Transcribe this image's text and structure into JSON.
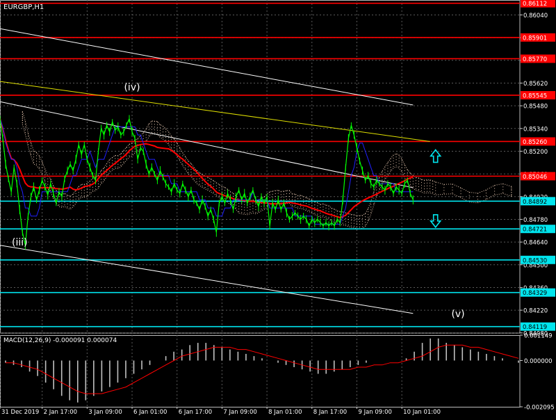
{
  "window_title": "EURGBP,H1",
  "indicator_label": "MACD(12,26,9) -0.000091 0.000074",
  "wave_labels": [
    {
      "text": "(iv)",
      "x": 47.0,
      "y": 0.85575
    },
    {
      "text": "(iii)",
      "x": 7.0,
      "y": 0.8462
    },
    {
      "text": "(v)",
      "x": 163.0,
      "y": 0.84177
    }
  ],
  "colors": {
    "background": "#000000",
    "grid": "#5a5a5a",
    "price": "#00ff00",
    "resistance": "#ff0000",
    "support": "#00e5ee",
    "channel": "#ffffff",
    "yellow_line": "#e0e000",
    "slow_ma": "#ff0000",
    "fast_ma": "#2020ff",
    "cloud": "#e8c8b0",
    "macd_hist": "#c0c0c0",
    "macd_signal": "#ff0000"
  },
  "chart_data": [
    {
      "type": "line",
      "title": "EURGBP,H1",
      "xlabel": "",
      "ylabel": "",
      "grid": true,
      "x_ticks": [
        {
          "label": "31 Dec 2019",
          "x": 0
        },
        {
          "label": "2 Jan 17:00",
          "x": 15
        },
        {
          "label": "3 Jan 09:00",
          "x": 31
        },
        {
          "label": "6 Jan 01:00",
          "x": 47
        },
        {
          "label": "6 Jan 17:00",
          "x": 63
        },
        {
          "label": "7 Jan 09:00",
          "x": 79
        },
        {
          "label": "8 Jan 01:00",
          "x": 95
        },
        {
          "label": "8 Jan 17:00",
          "x": 111
        },
        {
          "label": "9 Jan 09:00",
          "x": 127
        },
        {
          "label": "10 Jan 01:00",
          "x": 143
        }
      ],
      "xlim": [
        0,
        185
      ],
      "ylim": [
        0.84079,
        0.86132
      ],
      "y_ticks": [
        "0.86040",
        "0.85900",
        "0.85760",
        "0.85620",
        "0.85480",
        "0.85340",
        "0.85200",
        "0.85060",
        "0.84920",
        "0.84780",
        "0.84640",
        "0.84500",
        "0.84360",
        "0.84220",
        "0.84080"
      ],
      "resistance_levels": [
        "0.86112",
        "0.85901",
        "0.85770",
        "0.85545",
        "0.85260",
        "0.85046"
      ],
      "support_levels": [
        "0.84892",
        "0.84721",
        "0.84530",
        "0.84329",
        "0.84119"
      ],
      "price_series": [
        {
          "x": 0,
          "y": 0.854
        },
        {
          "x": 1,
          "y": 0.8528
        },
        {
          "x": 2,
          "y": 0.8512
        },
        {
          "x": 3,
          "y": 0.8503
        },
        {
          "x": 4,
          "y": 0.8495
        },
        {
          "x": 5,
          "y": 0.851
        },
        {
          "x": 6,
          "y": 0.85
        },
        {
          "x": 7,
          "y": 0.8484
        },
        {
          "x": 8,
          "y": 0.847
        },
        {
          "x": 9,
          "y": 0.8462
        },
        {
          "x": 10,
          "y": 0.848
        },
        {
          "x": 11,
          "y": 0.8492
        },
        {
          "x": 12,
          "y": 0.8498
        },
        {
          "x": 13,
          "y": 0.849
        },
        {
          "x": 14,
          "y": 0.8496
        },
        {
          "x": 15,
          "y": 0.8502
        },
        {
          "x": 16,
          "y": 0.8498
        },
        {
          "x": 17,
          "y": 0.8493
        },
        {
          "x": 18,
          "y": 0.85
        },
        {
          "x": 19,
          "y": 0.8494
        },
        {
          "x": 20,
          "y": 0.8488
        },
        {
          "x": 21,
          "y": 0.8495
        },
        {
          "x": 22,
          "y": 0.8492
        },
        {
          "x": 23,
          "y": 0.8503
        },
        {
          "x": 24,
          "y": 0.8508
        },
        {
          "x": 25,
          "y": 0.8512
        },
        {
          "x": 26,
          "y": 0.8508
        },
        {
          "x": 27,
          "y": 0.8515
        },
        {
          "x": 28,
          "y": 0.8524
        },
        {
          "x": 29,
          "y": 0.8518
        },
        {
          "x": 30,
          "y": 0.8524
        },
        {
          "x": 31,
          "y": 0.8515
        },
        {
          "x": 32,
          "y": 0.851
        },
        {
          "x": 33,
          "y": 0.8505
        },
        {
          "x": 34,
          "y": 0.8502
        },
        {
          "x": 35,
          "y": 0.852
        },
        {
          "x": 36,
          "y": 0.8534
        },
        {
          "x": 37,
          "y": 0.853
        },
        {
          "x": 38,
          "y": 0.8536
        },
        {
          "x": 39,
          "y": 0.8532
        },
        {
          "x": 40,
          "y": 0.8538
        },
        {
          "x": 41,
          "y": 0.8533
        },
        {
          "x": 42,
          "y": 0.8535
        },
        {
          "x": 43,
          "y": 0.853
        },
        {
          "x": 44,
          "y": 0.8532
        },
        {
          "x": 45,
          "y": 0.8536
        },
        {
          "x": 46,
          "y": 0.854
        },
        {
          "x": 47,
          "y": 0.8532
        },
        {
          "x": 48,
          "y": 0.8528
        },
        {
          "x": 49,
          "y": 0.8515
        },
        {
          "x": 50,
          "y": 0.8522
        },
        {
          "x": 51,
          "y": 0.852
        },
        {
          "x": 52,
          "y": 0.8512
        },
        {
          "x": 53,
          "y": 0.8506
        },
        {
          "x": 54,
          "y": 0.851
        },
        {
          "x": 55,
          "y": 0.8506
        },
        {
          "x": 56,
          "y": 0.8502
        },
        {
          "x": 57,
          "y": 0.8508
        },
        {
          "x": 58,
          "y": 0.8504
        },
        {
          "x": 59,
          "y": 0.85
        },
        {
          "x": 60,
          "y": 0.8498
        },
        {
          "x": 61,
          "y": 0.8495
        },
        {
          "x": 62,
          "y": 0.85
        },
        {
          "x": 63,
          "y": 0.8496
        },
        {
          "x": 64,
          "y": 0.8494
        },
        {
          "x": 65,
          "y": 0.85
        },
        {
          "x": 66,
          "y": 0.8496
        },
        {
          "x": 67,
          "y": 0.8492
        },
        {
          "x": 68,
          "y": 0.8496
        },
        {
          "x": 69,
          "y": 0.849
        },
        {
          "x": 70,
          "y": 0.8488
        },
        {
          "x": 71,
          "y": 0.8484
        },
        {
          "x": 72,
          "y": 0.849
        },
        {
          "x": 73,
          "y": 0.8486
        },
        {
          "x": 74,
          "y": 0.848
        },
        {
          "x": 75,
          "y": 0.8484
        },
        {
          "x": 76,
          "y": 0.8478
        },
        {
          "x": 77,
          "y": 0.847
        },
        {
          "x": 78,
          "y": 0.8488
        },
        {
          "x": 79,
          "y": 0.8492
        },
        {
          "x": 80,
          "y": 0.8488
        },
        {
          "x": 81,
          "y": 0.8494
        },
        {
          "x": 82,
          "y": 0.849
        },
        {
          "x": 83,
          "y": 0.8484
        },
        {
          "x": 84,
          "y": 0.8492
        },
        {
          "x": 85,
          "y": 0.8496
        },
        {
          "x": 86,
          "y": 0.849
        },
        {
          "x": 87,
          "y": 0.8494
        },
        {
          "x": 88,
          "y": 0.8488
        },
        {
          "x": 89,
          "y": 0.8492
        },
        {
          "x": 90,
          "y": 0.8496
        },
        {
          "x": 91,
          "y": 0.849
        },
        {
          "x": 92,
          "y": 0.8486
        },
        {
          "x": 93,
          "y": 0.8492
        },
        {
          "x": 94,
          "y": 0.8488
        },
        {
          "x": 95,
          "y": 0.8492
        },
        {
          "x": 96,
          "y": 0.8474
        },
        {
          "x": 97,
          "y": 0.8488
        },
        {
          "x": 98,
          "y": 0.8484
        },
        {
          "x": 99,
          "y": 0.849
        },
        {
          "x": 100,
          "y": 0.8484
        },
        {
          "x": 101,
          "y": 0.8488
        },
        {
          "x": 102,
          "y": 0.8482
        },
        {
          "x": 103,
          "y": 0.8478
        },
        {
          "x": 104,
          "y": 0.848
        },
        {
          "x": 105,
          "y": 0.8482
        },
        {
          "x": 106,
          "y": 0.848
        },
        {
          "x": 107,
          "y": 0.8478
        },
        {
          "x": 108,
          "y": 0.848
        },
        {
          "x": 109,
          "y": 0.8478
        },
        {
          "x": 110,
          "y": 0.8474
        },
        {
          "x": 111,
          "y": 0.8478
        },
        {
          "x": 112,
          "y": 0.8476
        },
        {
          "x": 113,
          "y": 0.8478
        },
        {
          "x": 114,
          "y": 0.8476
        },
        {
          "x": 115,
          "y": 0.8474
        },
        {
          "x": 116,
          "y": 0.8476
        },
        {
          "x": 117,
          "y": 0.8474
        },
        {
          "x": 118,
          "y": 0.8476
        },
        {
          "x": 119,
          "y": 0.8474
        },
        {
          "x": 120,
          "y": 0.8478
        },
        {
          "x": 121,
          "y": 0.8476
        },
        {
          "x": 122,
          "y": 0.849
        },
        {
          "x": 123,
          "y": 0.851
        },
        {
          "x": 124,
          "y": 0.8528
        },
        {
          "x": 125,
          "y": 0.8536
        },
        {
          "x": 126,
          "y": 0.853
        },
        {
          "x": 127,
          "y": 0.8522
        },
        {
          "x": 128,
          "y": 0.8514
        },
        {
          "x": 129,
          "y": 0.8508
        },
        {
          "x": 130,
          "y": 0.8502
        },
        {
          "x": 131,
          "y": 0.8505
        },
        {
          "x": 132,
          "y": 0.85
        },
        {
          "x": 133,
          "y": 0.8498
        },
        {
          "x": 134,
          "y": 0.8502
        },
        {
          "x": 135,
          "y": 0.85
        },
        {
          "x": 136,
          "y": 0.8498
        },
        {
          "x": 137,
          "y": 0.8496
        },
        {
          "x": 138,
          "y": 0.85
        },
        {
          "x": 139,
          "y": 0.8498
        },
        {
          "x": 140,
          "y": 0.8494
        },
        {
          "x": 141,
          "y": 0.8498
        },
        {
          "x": 142,
          "y": 0.8496
        },
        {
          "x": 143,
          "y": 0.8494
        },
        {
          "x": 144,
          "y": 0.85
        },
        {
          "x": 145,
          "y": 0.8502
        },
        {
          "x": 146,
          "y": 0.8494
        },
        {
          "x": 147,
          "y": 0.849
        }
      ],
      "trend_lines": [
        {
          "kind": "channel",
          "x1": 0,
          "y1": 0.85955,
          "x2": 147,
          "y2": 0.85485
        },
        {
          "kind": "channel",
          "x1": 0,
          "y1": 0.85505,
          "x2": 147,
          "y2": 0.84975
        },
        {
          "kind": "channel",
          "x1": 0,
          "y1": 0.8462,
          "x2": 147,
          "y2": 0.842
        },
        {
          "kind": "yellow",
          "x1": 0,
          "y1": 0.8563,
          "x2": 153,
          "y2": 0.8526
        }
      ],
      "arrows": [
        {
          "direction": "up",
          "x": 155,
          "y": 0.8517
        },
        {
          "direction": "down",
          "x": 155,
          "y": 0.8477
        }
      ]
    },
    {
      "type": "bar",
      "title": "MACD(12,26,9) -0.000091 0.000074",
      "ylim": [
        -0.002095,
        0.001149
      ],
      "y_ticks": [
        "0.001149",
        "0.000000",
        "-0.002095"
      ],
      "series": [
        {
          "name": "MACD",
          "values": [
            -0.0001,
            -0.0002,
            -0.0003,
            -0.0005,
            -0.0007,
            -0.001,
            -0.0013,
            -0.0016,
            -0.0018,
            -0.0019,
            -0.0018,
            -0.0016,
            -0.0014,
            -0.0012,
            -0.001,
            -0.0008,
            -0.0006,
            -0.0004,
            -0.0002,
            0.0,
            0.0002,
            0.0004,
            0.0005,
            0.0007,
            0.0008,
            0.0008,
            0.0007,
            0.0006,
            0.0005,
            0.0004,
            0.0003,
            0.0002,
            0.0001,
            0.0,
            -0.0001,
            -0.0002,
            -0.0003,
            -0.0004,
            -0.0005,
            -0.0006,
            -0.0006,
            -0.0005,
            -0.0004,
            -0.0003,
            -0.0002,
            -0.0001,
            0.0,
            0.0,
            0.0,
            0.0,
            0.0001,
            0.0004,
            0.0008,
            0.001,
            0.001,
            0.0008,
            0.0007,
            0.0006,
            0.0005,
            0.0004,
            0.0003,
            0.0002,
            0.0001,
            0.0,
            -0.0001
          ]
        },
        {
          "name": "Signal",
          "values": [
            -0.0001,
            -0.0001,
            -0.0002,
            -0.0003,
            -0.0004,
            -0.0006,
            -0.0008,
            -0.001,
            -0.0012,
            -0.0014,
            -0.0015,
            -0.0015,
            -0.0015,
            -0.0014,
            -0.0013,
            -0.0012,
            -0.001,
            -0.0008,
            -0.0006,
            -0.0004,
            -0.0002,
            0.0,
            0.0002,
            0.0003,
            0.0004,
            0.0005,
            0.0006,
            0.0006,
            0.0006,
            0.0005,
            0.0005,
            0.0004,
            0.0003,
            0.0002,
            0.0001,
            0.0,
            -0.0001,
            -0.0002,
            -0.0003,
            -0.0004,
            -0.0004,
            -0.0004,
            -0.0004,
            -0.0004,
            -0.0003,
            -0.0003,
            -0.0002,
            -0.0002,
            -0.0001,
            -0.0001,
            0.0,
            0.0001,
            0.0002,
            0.0004,
            0.0006,
            0.0007,
            0.0007,
            0.0007,
            0.0006,
            0.0006,
            0.0005,
            0.0004,
            0.0003,
            0.0002,
            0.0001
          ]
        }
      ]
    }
  ]
}
